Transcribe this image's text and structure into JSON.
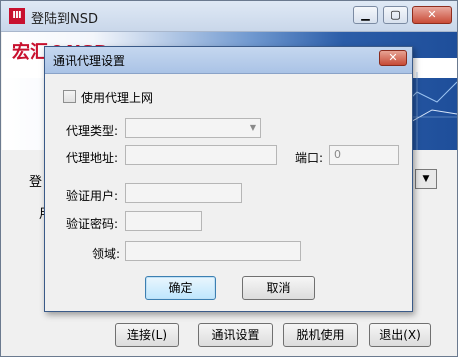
{
  "main": {
    "title": "登陆到NSD",
    "logo_text": "宏汇®NSD",
    "label_login": "登",
    "label_user": "用",
    "buttons": {
      "connect": "连接(L)",
      "comm_settings": "通讯设置",
      "offline": "脱机使用",
      "exit": "退出(X)"
    }
  },
  "dialog": {
    "title": "通讯代理设置",
    "close_glyph": "✕",
    "use_proxy_label": "使用代理上网",
    "use_proxy_checked": false,
    "proxy_type_label": "代理类型:",
    "proxy_type_value": "",
    "proxy_address_label": "代理地址:",
    "proxy_address_value": "",
    "port_label": "端口:",
    "port_value": "0",
    "auth_user_label": "验证用户:",
    "auth_user_value": "",
    "auth_password_label": "验证密码:",
    "auth_password_value": "",
    "domain_label": "领域:",
    "domain_value": "",
    "ok_label": "确定",
    "cancel_label": "取消"
  },
  "colors": {
    "accent": "#c8102e",
    "banner_blue": "#1e4e9a"
  }
}
